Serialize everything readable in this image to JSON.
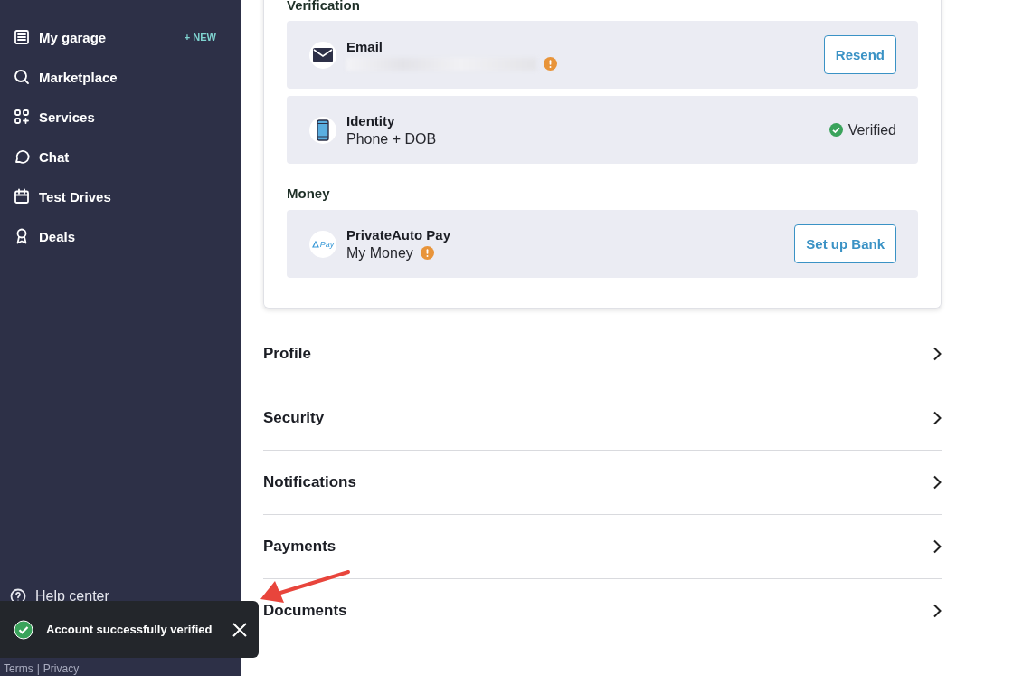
{
  "sidebar": {
    "nav": [
      {
        "label": "My garage",
        "badge": "+ NEW"
      },
      {
        "label": "Marketplace"
      },
      {
        "label": "Services"
      },
      {
        "label": "Chat"
      },
      {
        "label": "Test Drives"
      },
      {
        "label": "Deals"
      }
    ],
    "footer": [
      {
        "label": "Help center"
      }
    ],
    "legal": {
      "links": [
        "Terms",
        "Privacy"
      ],
      "separator": "|"
    }
  },
  "verification": {
    "title": "Verification",
    "items": [
      {
        "kind": "action",
        "title": "Email",
        "redacted": true,
        "warning": true,
        "button": "Resend"
      },
      {
        "kind": "status",
        "title": "Identity",
        "subtitle": "Phone + DOB",
        "status": "Verified"
      }
    ]
  },
  "money": {
    "title": "Money",
    "items": [
      {
        "kind": "action",
        "title": "PrivateAuto Pay",
        "subtitle": "My Money",
        "logo_text": "Pay",
        "warning": true,
        "button": "Set up Bank"
      }
    ]
  },
  "sections": [
    "Profile",
    "Security",
    "Notifications",
    "Payments",
    "Documents"
  ],
  "toast": {
    "message": "Account successfully verified"
  }
}
